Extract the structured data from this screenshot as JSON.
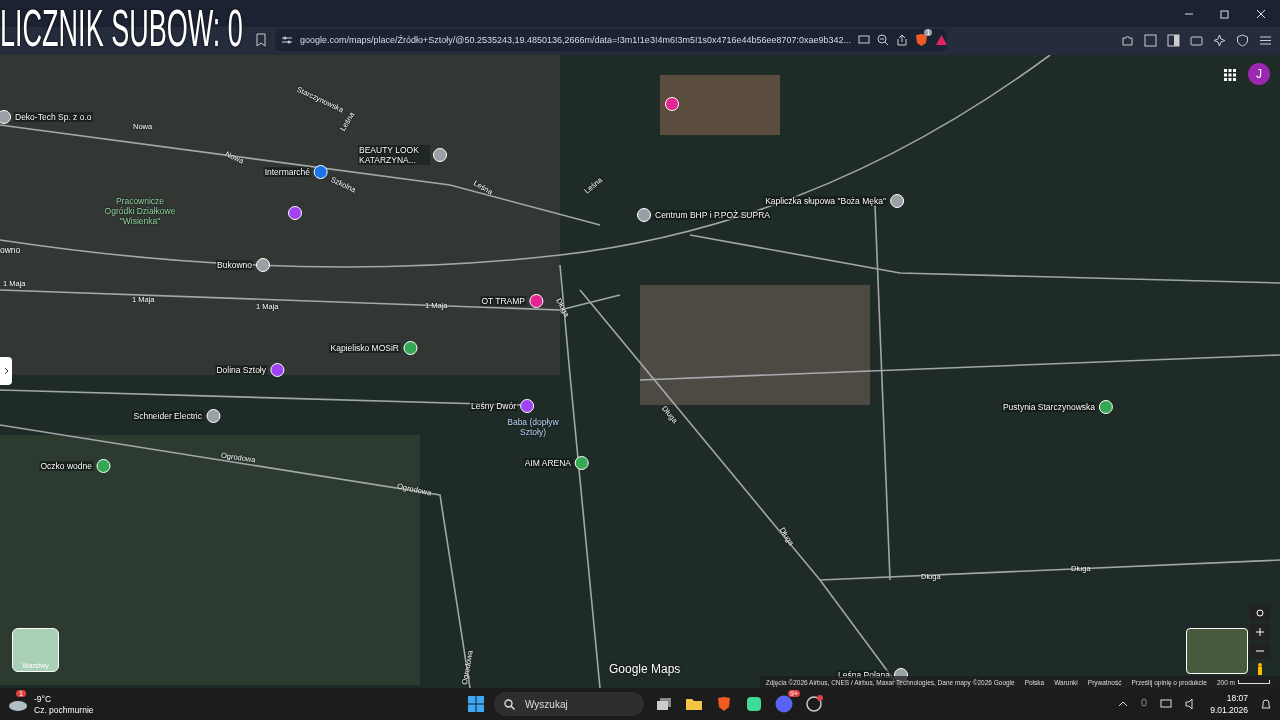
{
  "overlay": {
    "text": "LICZNIK SUBOW: 0"
  },
  "browser": {
    "url": "google.com/maps/place/Źródło+Sztoły/@50.2535243,19.4850136,2666m/data=!3m1!1e3!4m6!3m5!1s0x4716e44b56ee8707:0xae9b342...",
    "extension_badge": "1"
  },
  "map": {
    "avatar": "J",
    "layers_label": "Warstwy",
    "logo": "Google Maps",
    "places": [
      {
        "text": "Deko-Tech Sp. z o.o",
        "color": "#9aa0a6"
      },
      {
        "text": "BEAUTY LOOK KATARZYNA...",
        "color": "#9aa0a6"
      },
      {
        "text": "Intermarché",
        "color": "#1a73e8"
      },
      {
        "color": "#a142f4"
      },
      {
        "text": "Bukowno",
        "color": "#9aa0a6"
      },
      {
        "color": "#e52592"
      },
      {
        "text": "Centrum BHP i P.POŻ SUPRA",
        "color": "#9aa0a6"
      },
      {
        "text": "Kapliczka słupowa \"Boża Męka\"",
        "color": "#9aa0a6"
      },
      {
        "text": "OT TRAMP",
        "color": "#e52592"
      },
      {
        "text": "Kąpielisko MOSiR",
        "color": "#34a853"
      },
      {
        "text": "Dolina Sztoły",
        "color": "#a142f4"
      },
      {
        "text": "Leśny Dwór",
        "color": "#a142f4"
      },
      {
        "text": "Schneider Electric",
        "color": "#9aa0a6"
      },
      {
        "text": "AIM ARENA",
        "color": "#34a853"
      },
      {
        "text": "Oczko wodne",
        "color": "#34a853"
      },
      {
        "text": "Pustynia Starczynowska",
        "color": "#34a853"
      },
      {
        "text": "Leśna Polana",
        "color": "#9aa0a6"
      }
    ],
    "areas": [
      {
        "text": "Pracownicze Ogródki Działkowe \"Wisienka\"",
        "kind": "garden"
      },
      {
        "text": "Baba (dopływ Sztoły)",
        "kind": "water"
      },
      {
        "text": "owno",
        "kind": "town"
      }
    ],
    "streets": [
      "Nowa",
      "Nowa",
      "Szkolna",
      "Leśna",
      "Leśna",
      "Leśna",
      "Starczynowska",
      "1 Maja",
      "1 Maja",
      "1 Maja",
      "1 Maja",
      "Długa",
      "Długa",
      "Długa",
      "Długa",
      "Długa",
      "Ogrodowa",
      "Ogrodowa",
      "Ogrodowa"
    ],
    "footer": [
      "Zdjęcia ©2026 Airbus, CNES / Airbus, Maxar Technologies, Dane mapy ©2026 Google",
      "Polska",
      "Warunki",
      "Prywatność",
      "Prześlij opinię o produkcie"
    ],
    "scale": "200 m"
  },
  "taskbar": {
    "temperature": "-9°C",
    "weather": "Cz. pochmurnie",
    "weather_badge": "1",
    "search_placeholder": "Wyszukaj",
    "chat_badge": "9+",
    "time": "18:07",
    "date": "9.01.2026"
  }
}
